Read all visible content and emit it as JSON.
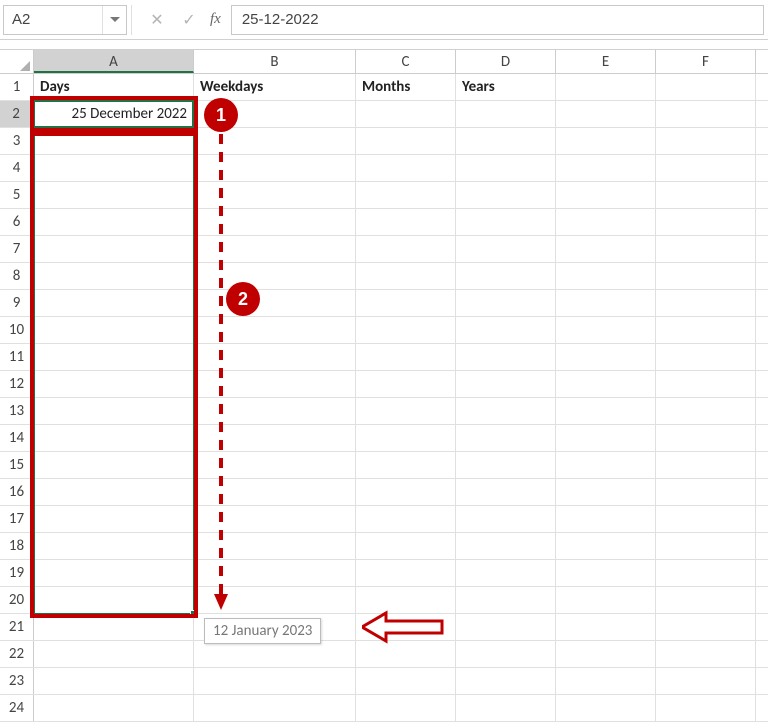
{
  "nameBox": {
    "value": "A2"
  },
  "formulaBar": {
    "value": "25-12-2022",
    "fxLabel": "fx"
  },
  "columns": [
    "A",
    "B",
    "C",
    "D",
    "E",
    "F"
  ],
  "rowCount": 24,
  "headers": {
    "A1": "Days",
    "B1": "Weekdays",
    "C1": "Months",
    "D1": "Years"
  },
  "cells": {
    "A2": "25 December 2022"
  },
  "tooltip": {
    "text": "12 January 2023"
  },
  "badges": {
    "one": "1",
    "two": "2"
  }
}
